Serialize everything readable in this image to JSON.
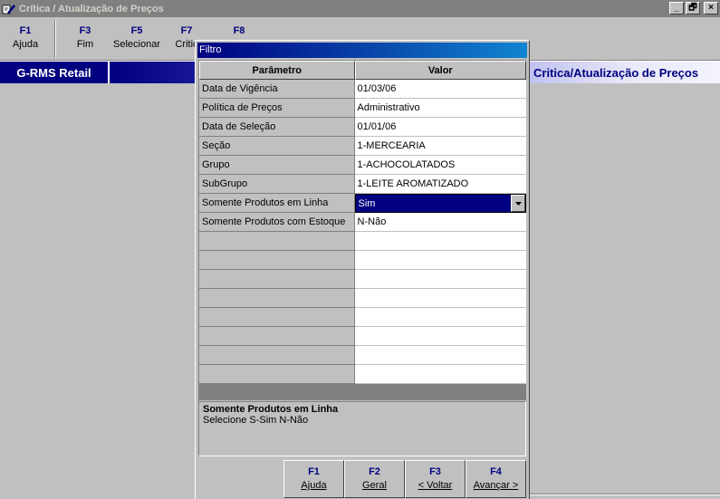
{
  "window": {
    "title": "Crítica / Atualização de Preços",
    "controls": [
      "_",
      "🗗",
      "×"
    ]
  },
  "toolbar": {
    "keys": [
      {
        "key": "F1",
        "label": "Ajuda"
      },
      {
        "key": "F3",
        "label": "Fim"
      },
      {
        "key": "F5",
        "label": "Selecionar"
      },
      {
        "key": "F7",
        "label": "Critic"
      },
      {
        "key": "F8",
        "label": ""
      }
    ]
  },
  "header": {
    "brand": "G-RMS Retail",
    "heading": "Critica/Atualização de Preços"
  },
  "dialog": {
    "title": "Filtro",
    "columns": {
      "param": "Parâmetro",
      "value": "Valor"
    },
    "rows": [
      {
        "param": "Data de Vigência",
        "value": "01/03/06"
      },
      {
        "param": "Política de Preços",
        "value": "Administrativo"
      },
      {
        "param": "Data de Seleção",
        "value": "01/01/06"
      },
      {
        "param": "Seção",
        "value": "1-MERCEARIA"
      },
      {
        "param": "Grupo",
        "value": "1-ACHOCOLATADOS"
      },
      {
        "param": "SubGrupo",
        "value": "1-LEITE AROMATIZADO"
      },
      {
        "param": "Somente Produtos em Linha",
        "value": "Sim"
      },
      {
        "param": "Somente Produtos com Estoque",
        "value": "N-Não"
      }
    ],
    "help": {
      "title": "Somente Produtos em Linha",
      "text": "Selecione S-Sim N-Não"
    },
    "buttons": [
      {
        "key": "F1",
        "label": "Ajuda"
      },
      {
        "key": "F2",
        "label": "Geral"
      },
      {
        "key": "F3",
        "label": "< Voltar"
      },
      {
        "key": "F4",
        "label": "Avançar >"
      }
    ]
  },
  "colors": {
    "navy": "#000080",
    "face": "#c0c0c0",
    "titlebar_inactive": "#808080"
  }
}
